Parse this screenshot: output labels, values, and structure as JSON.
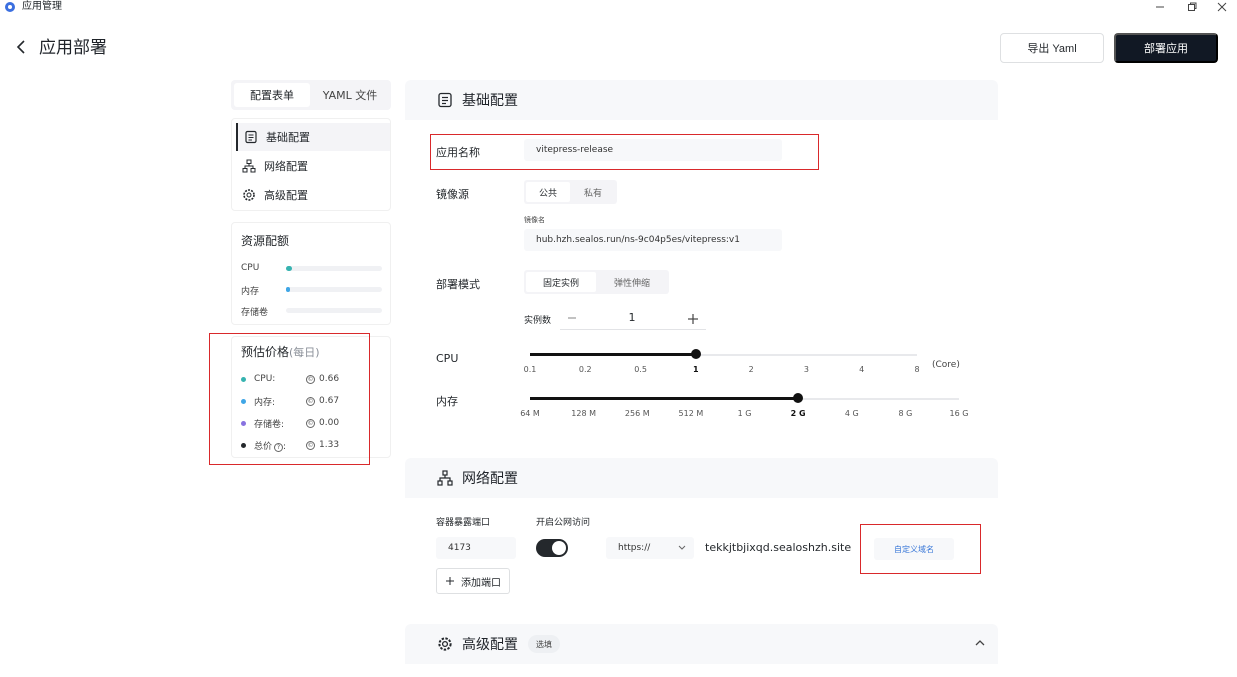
{
  "window": {
    "title": "应用管理"
  },
  "header": {
    "title": "应用部署",
    "export_label": "导出 Yaml",
    "deploy_label": "部署应用"
  },
  "left_tabs": [
    {
      "label": "配置表单",
      "active": true
    },
    {
      "label": "YAML 文件",
      "active": false
    }
  ],
  "nav": [
    {
      "label": "基础配置",
      "icon": "document-icon",
      "active": true
    },
    {
      "label": "网络配置",
      "icon": "network-icon",
      "active": false
    },
    {
      "label": "高级配置",
      "icon": "gear-icon",
      "active": false
    }
  ],
  "resources": {
    "title": "资源配额",
    "items": [
      {
        "label": "CPU",
        "color": "#36b3b0",
        "fraction": 0.06
      },
      {
        "label": "内存",
        "color": "#3fa6e6",
        "fraction": 0.03
      },
      {
        "label": "存储卷",
        "color": "#8872e0",
        "fraction": 0.0
      }
    ]
  },
  "price": {
    "title": "预估价格",
    "subtitle": "(每日)",
    "items": [
      {
        "label": "CPU:",
        "value": "0.66",
        "color": "#36b3b0"
      },
      {
        "label": "内存:",
        "value": "0.67",
        "color": "#3fa6e6"
      },
      {
        "label": "存储卷:",
        "value": "0.00",
        "color": "#8872e0"
      },
      {
        "label": "总价",
        "value": "1.33",
        "color": "#24282c"
      }
    ]
  },
  "basic": {
    "title": "基础配置",
    "app_name_label": "应用名称",
    "app_name_value": "vitepress-release",
    "image_source_label": "镜像源",
    "image_source_options": [
      "公共",
      "私有"
    ],
    "image_name_label": "镜像名",
    "image_name_value": "hub.hzh.sealos.run/ns-9c04p5es/vitepress:v1",
    "deploy_mode_label": "部署模式",
    "deploy_mode_options": [
      "固定实例",
      "弹性伸缩"
    ],
    "replicas_label": "实例数",
    "replicas_value": "1",
    "cpu_label": "CPU",
    "cpu_ticks": [
      "0.1",
      "0.2",
      "0.5",
      "1",
      "2",
      "3",
      "4",
      "8"
    ],
    "cpu_unit": "(Core)",
    "cpu_selected": "1",
    "mem_label": "内存",
    "mem_ticks": [
      "64 M",
      "128 M",
      "256 M",
      "512 M",
      "1 G",
      "2 G",
      "4 G",
      "8 G",
      "16 G"
    ],
    "mem_selected": "2 G"
  },
  "network": {
    "title": "网络配置",
    "port_label": "容器暴露端口",
    "port_value": "4173",
    "public_label": "开启公网访问",
    "public_enabled": true,
    "protocol": "https://",
    "domain": "tekkjtbjixqd.sealoshzh.site",
    "custom_domain_label": "自定义域名",
    "add_port_label": "添加端口"
  },
  "advanced": {
    "title": "高级配置",
    "badge": "选填"
  }
}
